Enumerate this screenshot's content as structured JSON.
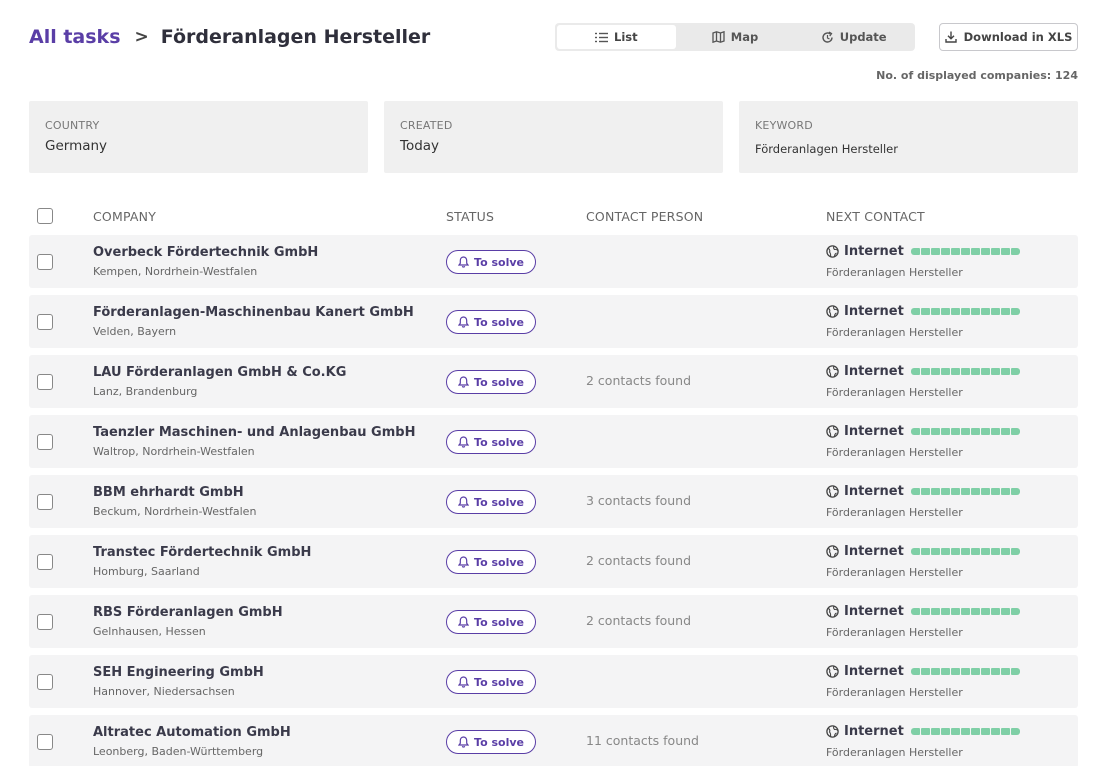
{
  "breadcrumb": {
    "root": "All tasks",
    "current": "Förderanlagen Hersteller"
  },
  "view_toggle": [
    {
      "label": "List",
      "icon": "list-icon",
      "active": true
    },
    {
      "label": "Map",
      "icon": "map-icon",
      "active": false
    },
    {
      "label": "Update",
      "icon": "refresh-icon",
      "active": false
    }
  ],
  "download_label": "Download in XLS",
  "count_text": "No. of displayed companies: 124",
  "filters": [
    {
      "label": "COUNTRY",
      "value": "Germany"
    },
    {
      "label": "CREATED",
      "value": "Today"
    },
    {
      "label": "KEYWORD",
      "value": "Förderanlagen Hersteller"
    }
  ],
  "columns": {
    "company": "COMPANY",
    "status": "STATUS",
    "contact": "CONTACT PERSON",
    "next": "NEXT CONTACT"
  },
  "colors": {
    "accent": "#5a3ea6",
    "progress": "#7fcfa6"
  },
  "rows": [
    {
      "name": "Overbeck Fördertechnik GmbH",
      "location": "Kempen, Nordrhein-Westfalen",
      "status": "To solve",
      "contacts": "",
      "channel": "Internet",
      "keyword": "Förderanlagen Hersteller",
      "progress": 1.0
    },
    {
      "name": "Förderanlagen-Maschinenbau Kanert GmbH",
      "location": "Velden, Bayern",
      "status": "To solve",
      "contacts": "",
      "channel": "Internet",
      "keyword": "Förderanlagen Hersteller",
      "progress": 1.0
    },
    {
      "name": "LAU Förderanlagen GmbH & Co.KG",
      "location": "Lanz, Brandenburg",
      "status": "To solve",
      "contacts": "2 contacts found",
      "channel": "Internet",
      "keyword": "Förderanlagen Hersteller",
      "progress": 1.0
    },
    {
      "name": "Taenzler Maschinen- und Anlagenbau GmbH",
      "location": "Waltrop, Nordrhein-Westfalen",
      "status": "To solve",
      "contacts": "",
      "channel": "Internet",
      "keyword": "Förderanlagen Hersteller",
      "progress": 1.0
    },
    {
      "name": "BBM ehrhardt GmbH",
      "location": "Beckum, Nordrhein-Westfalen",
      "status": "To solve",
      "contacts": "3 contacts found",
      "channel": "Internet",
      "keyword": "Förderanlagen Hersteller",
      "progress": 1.0
    },
    {
      "name": "Transtec Fördertechnik GmbH",
      "location": "Homburg, Saarland",
      "status": "To solve",
      "contacts": "2 contacts found",
      "channel": "Internet",
      "keyword": "Förderanlagen Hersteller",
      "progress": 1.0
    },
    {
      "name": "RBS Förderanlagen GmbH",
      "location": "Gelnhausen, Hessen",
      "status": "To solve",
      "contacts": "2 contacts found",
      "channel": "Internet",
      "keyword": "Förderanlagen Hersteller",
      "progress": 1.0
    },
    {
      "name": "SEH Engineering GmbH",
      "location": "Hannover, Niedersachsen",
      "status": "To solve",
      "contacts": "",
      "channel": "Internet",
      "keyword": "Förderanlagen Hersteller",
      "progress": 1.0
    },
    {
      "name": "Altratec Automation GmbH",
      "location": "Leonberg, Baden-Württemberg",
      "status": "To solve",
      "contacts": "11 contacts found",
      "channel": "Internet",
      "keyword": "Förderanlagen Hersteller",
      "progress": 1.0
    }
  ]
}
